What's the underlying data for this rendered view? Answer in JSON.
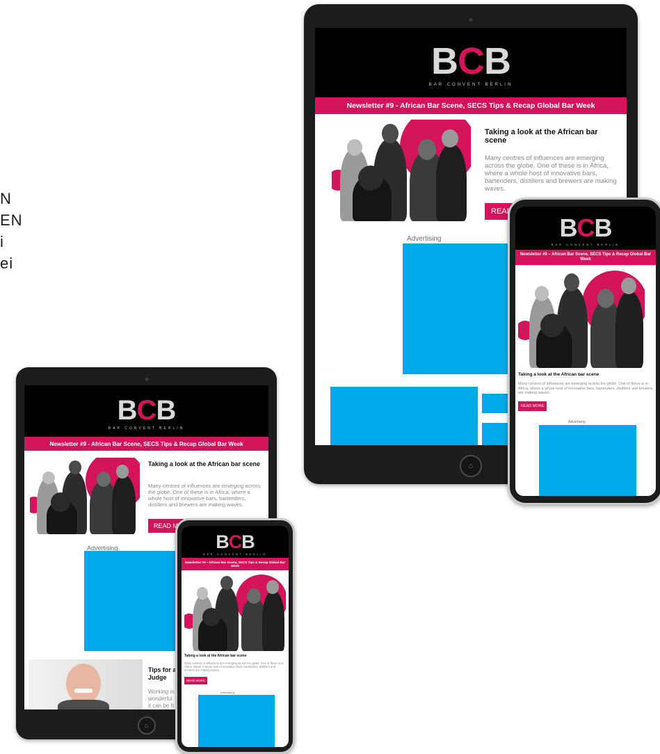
{
  "side_text": [
    "N",
    "EN",
    "i",
    "ei"
  ],
  "newsletter": {
    "logo_b1": "B",
    "logo_c": "C",
    "logo_b2": "B",
    "logo_subtitle": "BAR CONVENT BERLIN",
    "banner_title": "Newsletter #9 - African Bar Scene, SECS Tips & Recap Global Bar Week",
    "banner_title_short": "Newsletter #9 – African Bar Scene, SECS Tips & Recap Global Bar Week",
    "article_title": "Taking a look at the African bar scene",
    "article_body": "Many centres of influences are emerging across the globe. One of these is in Africa, where a whole host of innovative bars, bartenders, distillers and brewers are making waves.",
    "read_more": "READ MORE",
    "read_more_partial_large": "READ M",
    "read_more_partial_small": "READ M",
    "advertising": "Advertising",
    "tips_title": "Tips for a",
    "tips_title_line2": "Judge",
    "tips_body_line1": "Working in",
    "tips_body_line2": "wonderful",
    "tips_body_line3": "it can be h"
  },
  "colors": {
    "accent": "#d4145a",
    "ad": "#00a8e8",
    "frame": "#1c1c1e"
  },
  "icons": {
    "home_button": "home-icon"
  }
}
